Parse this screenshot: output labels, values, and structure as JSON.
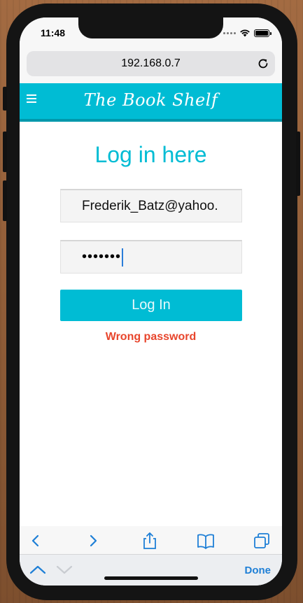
{
  "status_bar": {
    "time": "11:48"
  },
  "browser": {
    "url": "192.168.0.7"
  },
  "app": {
    "title": "The Book Shelf",
    "heading": "Log in here",
    "email_value": "Frederik_Batz@yahoo.",
    "password_mask": "•••••••",
    "login_label": "Log In",
    "error_text": "Wrong password"
  },
  "accessory": {
    "done_label": "Done"
  },
  "colors": {
    "accent": "#00bcd4",
    "error": "#e8452c",
    "ios_blue": "#1e7fd6"
  },
  "icons": [
    "hamburger-icon",
    "reload-icon",
    "back-icon",
    "forward-icon",
    "share-icon",
    "bookmarks-icon",
    "tabs-icon",
    "chevron-up-icon",
    "chevron-down-icon",
    "wifi-icon",
    "battery-icon"
  ]
}
